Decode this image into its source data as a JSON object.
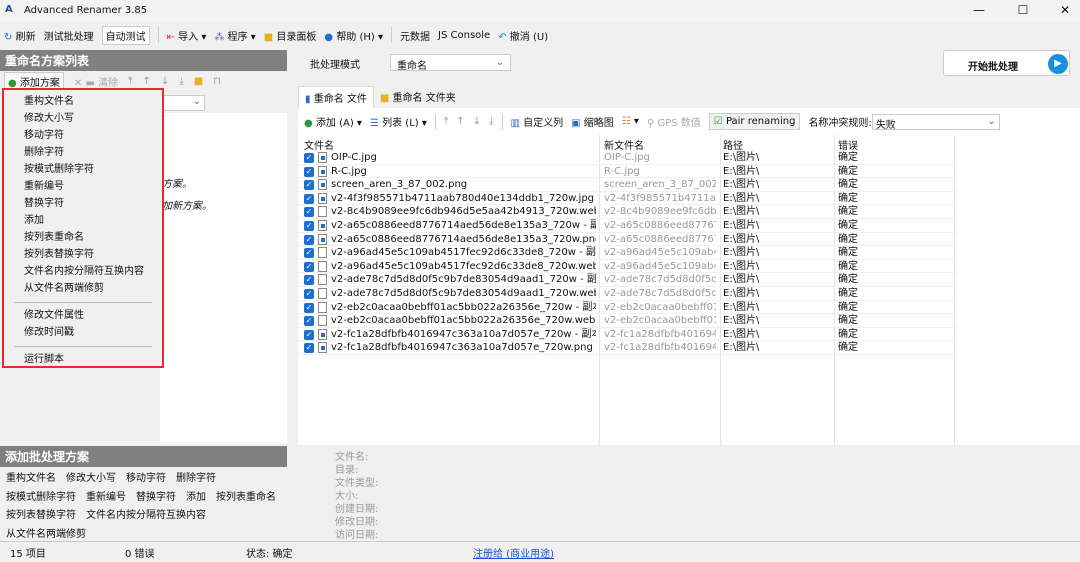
{
  "title": "Advanced Renamer 3.85",
  "toolbar": {
    "refresh": "刷新",
    "test_batch": "测试批处理",
    "auto_test": "自动测试",
    "import": "导入",
    "program": "程序",
    "dir_panel": "目录面板",
    "help": "帮助 (H)",
    "metadata": "元数据",
    "js_console": "JS Console",
    "undo": "撤消 (U)"
  },
  "left": {
    "header": "重命名方案列表",
    "add_method": "添加方案",
    "clear": "清除",
    "hint1": "方案。",
    "hint2": "加新方案。"
  },
  "menu": {
    "items": [
      "重构文件名",
      "修改大小写",
      "移动字符",
      "删除字符",
      "按模式删除字符",
      "重新编号",
      "替换字符",
      "添加",
      "按列表重命名",
      "按列表替换字符",
      "文件名内按分隔符互换内容",
      "从文件名两端修剪"
    ],
    "items2": [
      "修改文件属性",
      "修改时间戳"
    ],
    "items3": [
      "运行脚本"
    ]
  },
  "batch": {
    "label": "批处理模式",
    "value": "重命名",
    "start": "开始批处理"
  },
  "tabs": [
    "重命名 文件",
    "重命名 文件夹"
  ],
  "filetb": {
    "add": "添加 (A)",
    "list": "列表 (L)",
    "custom_cols": "自定义列",
    "thumbs": "缩略图",
    "gps": "GPS 数值",
    "pair": "Pair renaming",
    "conflict_label": "名称冲突规则:",
    "conflict_value": "失败"
  },
  "columns": [
    "文件名",
    "新文件名",
    "路径",
    "错误"
  ],
  "files": [
    {
      "name": "OIP-C.jpg",
      "new": "OIP-C.jpg",
      "img": true
    },
    {
      "name": "R-C.jpg",
      "new": "R-C.jpg",
      "img": true
    },
    {
      "name": "screen_aren_3_87_002.png",
      "new": "screen_aren_3_87_002.png",
      "img": true
    },
    {
      "name": "v2-4f3f985571b4711aab780d40e134ddb1_720w.jpg",
      "new": "v2-4f3f985571b4711aab...",
      "img": true
    },
    {
      "name": "v2-8c4b9089ee9fc6db946d5e5aa42b4913_720w.webp",
      "new": "v2-8c4b9089ee9fc6db94...",
      "img": false
    },
    {
      "name": "v2-a65c0886eed8776714aed56de8e135a3_720w - 副本.png",
      "new": "v2-a65c0886eed8776714...",
      "img": true
    },
    {
      "name": "v2-a65c0886eed8776714aed56de8e135a3_720w.png",
      "new": "v2-a65c0886eed8776714...",
      "img": true
    },
    {
      "name": "v2-a96ad45e5c109ab4517fec92d6c33de8_720w - 副本.webp",
      "new": "v2-a96ad45e5c109ab451...",
      "img": false
    },
    {
      "name": "v2-a96ad45e5c109ab4517fec92d6c33de8_720w.webp",
      "new": "v2-a96ad45e5c109ab451...",
      "img": false
    },
    {
      "name": "v2-ade78c7d5d8d0f5c9b7de83054d9aad1_720w - 副本.webp",
      "new": "v2-ade78c7d5d8d0f5c9b...",
      "img": false
    },
    {
      "name": "v2-ade78c7d5d8d0f5c9b7de83054d9aad1_720w.webp",
      "new": "v2-ade78c7d5d8d0f5c9b...",
      "img": false
    },
    {
      "name": "v2-eb2c0acaa0bebff01ac5bb022a26356e_720w - 副本.webp",
      "new": "v2-eb2c0acaa0bebff01ac...",
      "img": false
    },
    {
      "name": "v2-eb2c0acaa0bebff01ac5bb022a26356e_720w.webp",
      "new": "v2-eb2c0acaa0bebff01ac...",
      "img": false
    },
    {
      "name": "v2-fc1a28dfbfb4016947c363a10a7d057e_720w - 副本.png",
      "new": "v2-fc1a28dfbfb4016947c...",
      "img": true
    },
    {
      "name": "v2-fc1a28dfbfb4016947c363a10a7d057e_720w.png",
      "new": "v2-fc1a28dfbfb4016947c...",
      "img": true
    }
  ],
  "path": "E:\\图片\\",
  "error": "确定",
  "addbatch": {
    "header": "添加批处理方案",
    "lines": [
      [
        "重构文件名",
        "修改大小写",
        "移动字符",
        "删除字符"
      ],
      [
        "按模式删除字符",
        "重新编号",
        "替换字符",
        "添加",
        "按列表重命名"
      ],
      [
        "按列表替换字符",
        "文件名内按分隔符互换内容"
      ],
      [
        "从文件名两端修剪"
      ]
    ]
  },
  "info": [
    "文件名:",
    "目录:",
    "文件类型:",
    "大小:",
    "创建日期:",
    "修改日期:",
    "访问日期:"
  ],
  "status": {
    "items": "15 项目",
    "errors": "0 错误",
    "state": "状态: 确定",
    "reg": "注册给 (商业用途)"
  }
}
